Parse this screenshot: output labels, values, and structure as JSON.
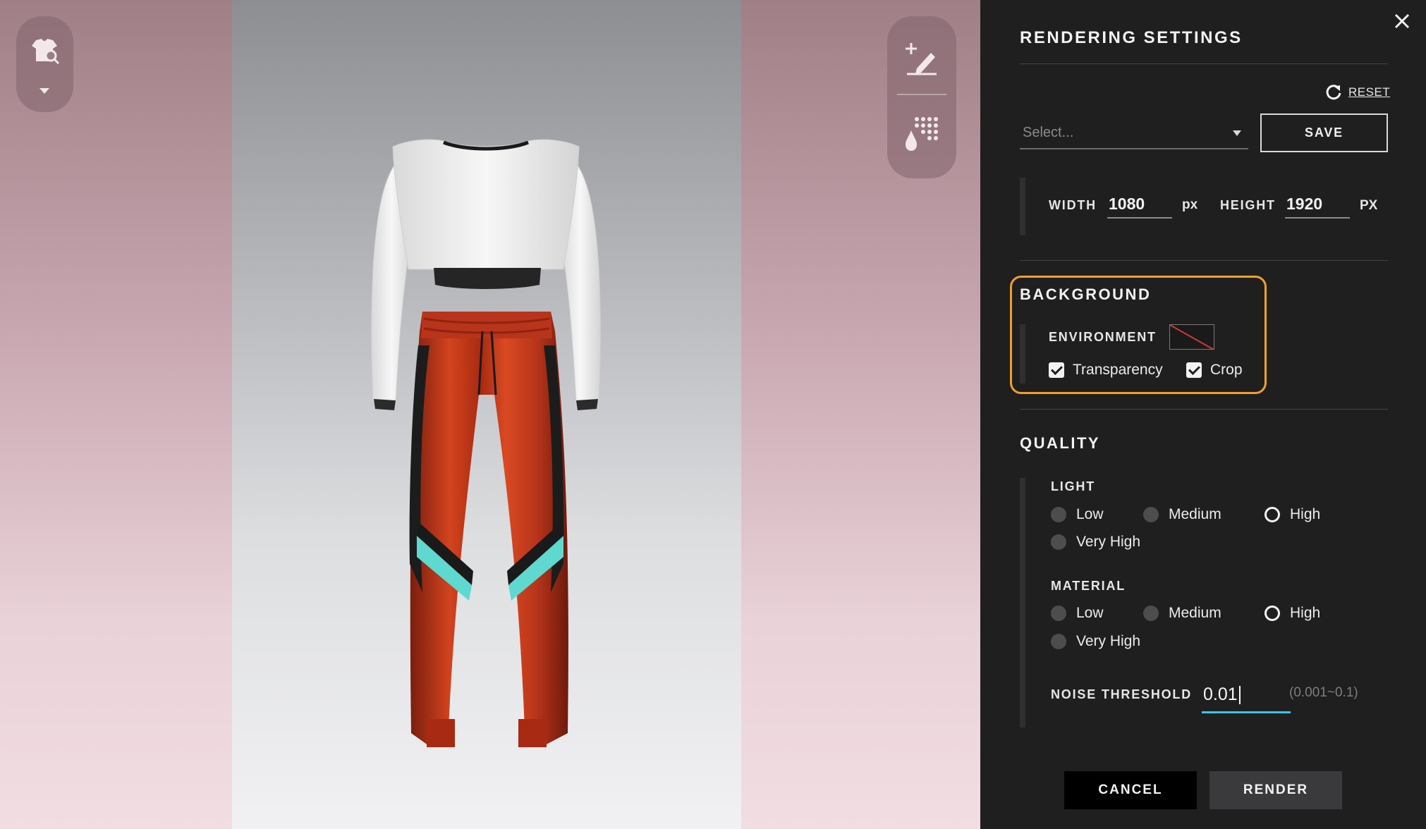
{
  "viewport": {
    "left_tool": {
      "icon": "garment-search-icon",
      "dropdown_icon": "caret-down-icon"
    },
    "right_tool": {
      "icons": [
        "add-annotation-icon",
        "texture-dropper-icon"
      ]
    },
    "garment": {
      "description_icon": "avatar-garment"
    }
  },
  "panel": {
    "title": "RENDERING SETTINGS",
    "close_icon": "close-icon",
    "reset_label": "RESET",
    "preset": {
      "placeholder": "Select...",
      "save_label": "SAVE"
    },
    "size": {
      "width_label": "WIDTH",
      "width_value": "1080",
      "width_unit": "px",
      "height_label": "HEIGHT",
      "height_value": "1920",
      "height_unit": "PX"
    },
    "background": {
      "title": "BACKGROUND",
      "environment_label": "ENVIRONMENT",
      "transparency_label": "Transparency",
      "transparency_checked": true,
      "crop_label": "Crop",
      "crop_checked": true,
      "highlight_color": "#f0a02a"
    },
    "quality": {
      "title": "QUALITY",
      "light": {
        "label": "LIGHT",
        "options": [
          "Low",
          "Medium",
          "High",
          "Very High"
        ],
        "selected": "High"
      },
      "material": {
        "label": "MATERIAL",
        "options": [
          "Low",
          "Medium",
          "High",
          "Very High"
        ],
        "selected": "High"
      },
      "noise": {
        "label": "NOISE THRESHOLD",
        "value": "0.01",
        "range": "(0.001~0.1)",
        "accent": "#37c6ea"
      }
    },
    "cancel_label": "CANCEL",
    "render_label": "RENDER"
  }
}
